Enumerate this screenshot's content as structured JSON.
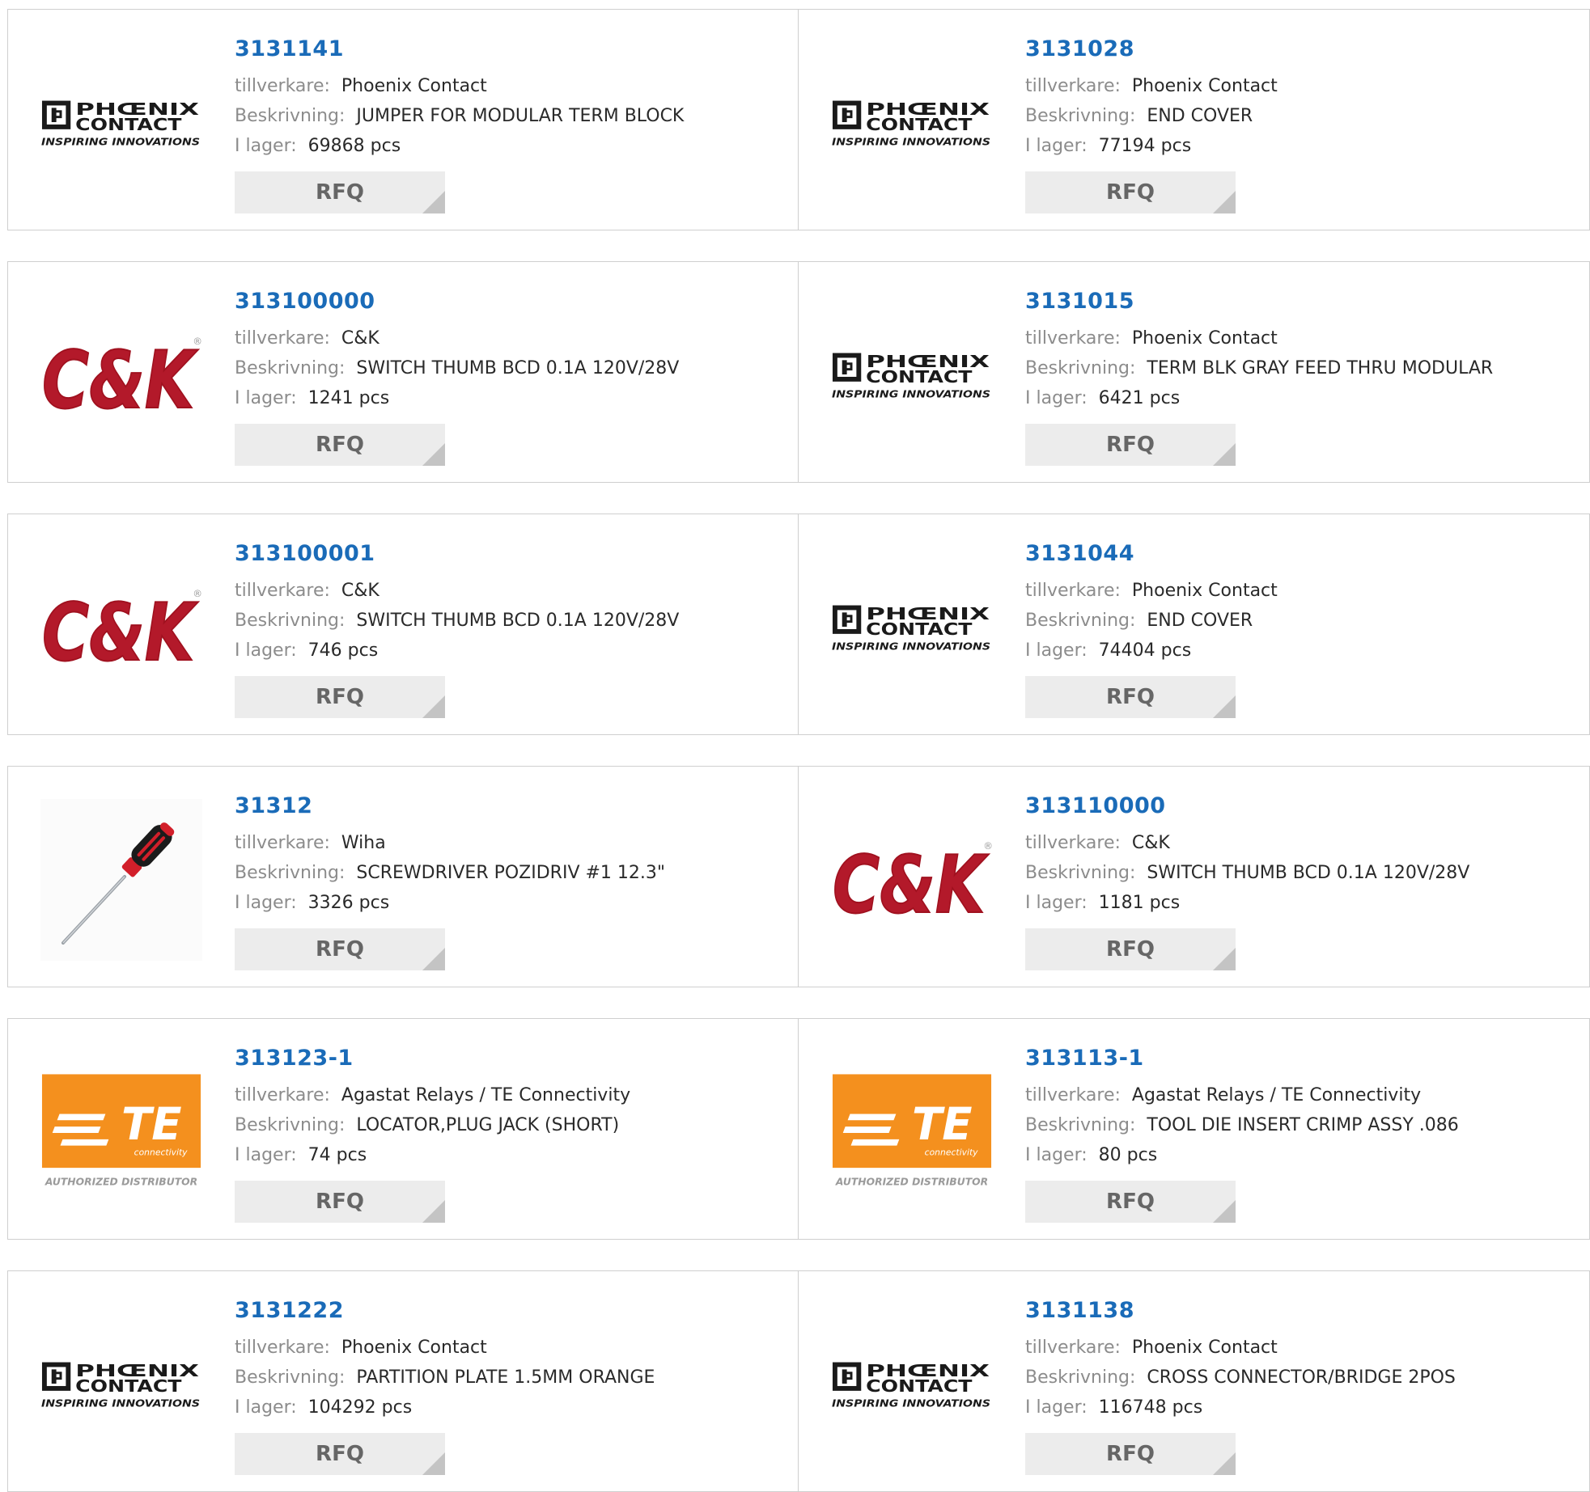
{
  "labels": {
    "manufacturer": "tillverkare:",
    "description": "Beskrivning:",
    "stock": "I lager:",
    "rfq": "RFQ"
  },
  "brand_logos": {
    "phoenix": {
      "line1": "PHŒNIX",
      "line2": "CONTACT",
      "tagline": "INSPIRING INNOVATIONS"
    },
    "ck": {
      "text": "C&K",
      "reg": "®"
    },
    "te": {
      "text": "TE",
      "sub": "connectivity",
      "tagline": "AUTHORIZED DISTRIBUTOR"
    }
  },
  "colors": {
    "part_link": "#1a6bb8",
    "ck_red": "#b3192a",
    "te_orange": "#f4901e",
    "rfq_bg": "#ececec"
  },
  "products": [
    {
      "part": "3131141",
      "manufacturer": "Phoenix Contact",
      "description": "JUMPER FOR MODULAR TERM BLOCK",
      "stock": "69868 pcs",
      "logo": "phoenix"
    },
    {
      "part": "3131028",
      "manufacturer": "Phoenix Contact",
      "description": "END COVER",
      "stock": "77194 pcs",
      "logo": "phoenix"
    },
    {
      "part": "313100000",
      "manufacturer": "C&K",
      "description": "SWITCH THUMB BCD 0.1A 120V/28V",
      "stock": "1241 pcs",
      "logo": "ck"
    },
    {
      "part": "3131015",
      "manufacturer": "Phoenix Contact",
      "description": "TERM BLK GRAY FEED THRU MODULAR",
      "stock": "6421 pcs",
      "logo": "phoenix"
    },
    {
      "part": "313100001",
      "manufacturer": "C&K",
      "description": "SWITCH THUMB BCD 0.1A 120V/28V",
      "stock": "746 pcs",
      "logo": "ck"
    },
    {
      "part": "3131044",
      "manufacturer": "Phoenix Contact",
      "description": "END COVER",
      "stock": "74404 pcs",
      "logo": "phoenix"
    },
    {
      "part": "31312",
      "manufacturer": "Wiha",
      "description": "SCREWDRIVER POZIDRIV #1 12.3\"",
      "stock": "3326 pcs",
      "logo": "screwdriver"
    },
    {
      "part": "313110000",
      "manufacturer": "C&K",
      "description": "SWITCH THUMB BCD 0.1A 120V/28V",
      "stock": "1181 pcs",
      "logo": "ck"
    },
    {
      "part": "313123-1",
      "manufacturer": "Agastat Relays / TE Connectivity",
      "description": "LOCATOR,PLUG JACK (SHORT)",
      "stock": "74 pcs",
      "logo": "te"
    },
    {
      "part": "313113-1",
      "manufacturer": "Agastat Relays / TE Connectivity",
      "description": "TOOL DIE INSERT CRIMP ASSY .086",
      "stock": "80 pcs",
      "logo": "te"
    },
    {
      "part": "3131222",
      "manufacturer": "Phoenix Contact",
      "description": "PARTITION PLATE 1.5MM ORANGE",
      "stock": "104292 pcs",
      "logo": "phoenix"
    },
    {
      "part": "3131138",
      "manufacturer": "Phoenix Contact",
      "description": "CROSS CONNECTOR/BRIDGE 2POS",
      "stock": "116748 pcs",
      "logo": "phoenix"
    }
  ]
}
